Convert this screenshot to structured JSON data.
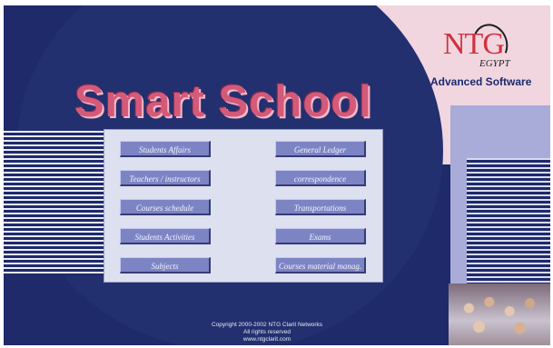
{
  "brand": {
    "title": "Smart School",
    "logo_text": "NTG",
    "logo_subtext": "EGYPT",
    "tagline": "Advanced Software"
  },
  "menu": {
    "left": [
      {
        "label": "Students Affairs"
      },
      {
        "label": "Teachers / instructors"
      },
      {
        "label": "Courses schedule"
      },
      {
        "label": "Students Activities"
      },
      {
        "label": "Subjects"
      }
    ],
    "right": [
      {
        "label": "General Ledger"
      },
      {
        "label": "correspondence"
      },
      {
        "label": "Transportations"
      },
      {
        "label": "Exams"
      },
      {
        "label": "Courses material manag."
      }
    ]
  },
  "footer": {
    "line1": "Copyright 2000-2002 NTG Clarit Networks",
    "line2": "All rights reserved",
    "line3": "www.ntgclarit.com"
  },
  "colors": {
    "background": "#1f2a6b",
    "accent_pink": "#f1d6df",
    "button": "#7d84c4",
    "title": "#d45a7a",
    "logo": "#d3303d"
  }
}
